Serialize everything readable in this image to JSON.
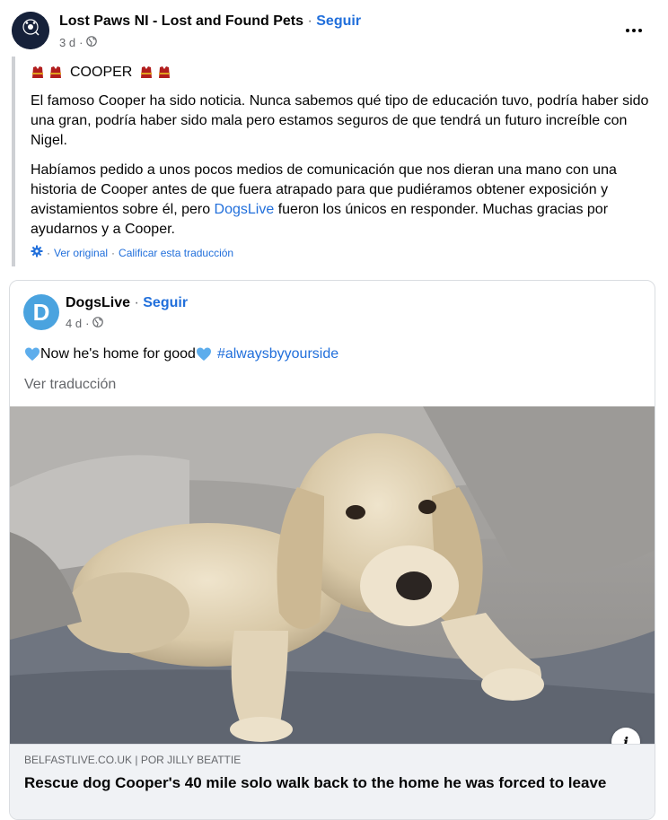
{
  "post": {
    "page_name": "Lost Paws NI - Lost and Found Pets",
    "separator": "·",
    "follow_label": "Seguir",
    "time": "3 d",
    "meta_separator": "·",
    "avatar_text": "LOST PAWS NI",
    "title": "COOPER",
    "paragraph1": "El famoso Cooper ha sido noticia. Nunca sabemos qué tipo de educación tuvo, podría haber sido una gran, podría haber sido mala pero estamos seguros de que tendrá un futuro increíble con Nigel.",
    "paragraph2_before": "Habíamos pedido a unos pocos medios de comunicación que nos dieran una mano con una historia de Cooper antes de que fuera atrapado para que pudiéramos obtener exposición y avistamientos sobre él, pero ",
    "paragraph2_link": "DogsLive",
    "paragraph2_after": " fueron los únicos en responder. Muchas gracias por ayudarnos y a Cooper.",
    "see_original": "Ver original",
    "rate_translation": "Calificar esta traducción",
    "translation_separator": "·"
  },
  "shared": {
    "avatar_letter": "D",
    "page_name": "DogsLive",
    "separator": "·",
    "follow_label": "Seguir",
    "time": "4 d",
    "text": "Now he's home for good",
    "hashtag": "#alwaysbyyourside",
    "see_translation": "Ver traducción",
    "link_domain": "BELFASTLIVE.CO.UK | POR JILLY BEATTIE",
    "link_title": "Rescue dog Cooper's 40 mile solo walk back to the home he was forced to leave"
  },
  "icons": {
    "privacy": "globe-icon",
    "more": "more-options-icon",
    "settings": "gear-icon",
    "info": "info-icon",
    "emoji_dress": "kimono-emoji",
    "emoji_heart": "blue-heart-emoji"
  },
  "colors": {
    "accent": "#216fdb",
    "muted": "#65676b",
    "divider": "#ced0d4",
    "heart": "#5dadec",
    "dress": "#b21e1e"
  }
}
